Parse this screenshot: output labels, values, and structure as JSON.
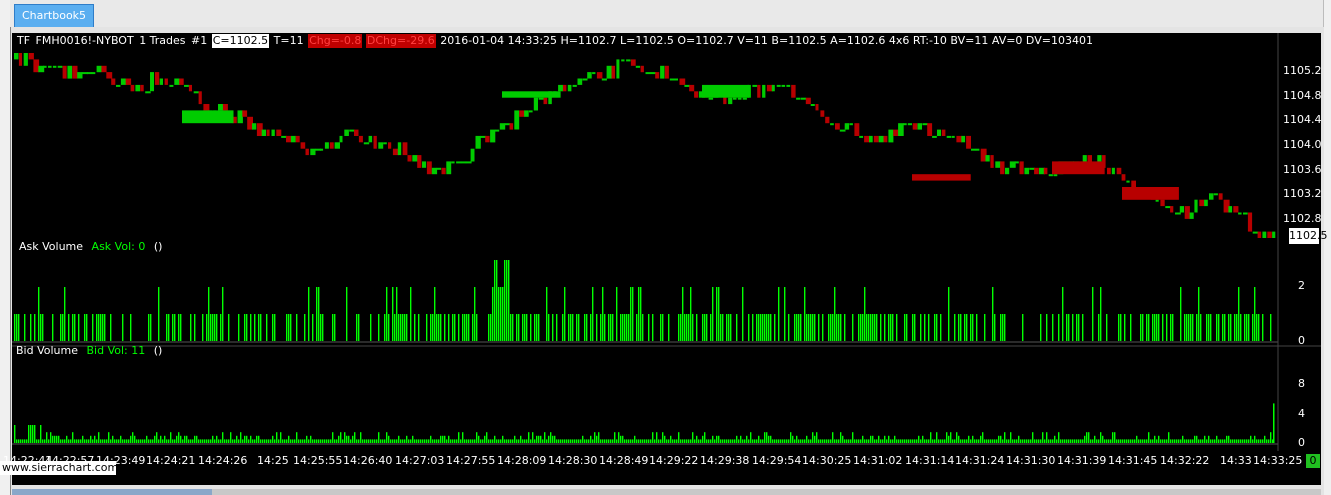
{
  "window": {
    "tab_label": "Chartbook5"
  },
  "header": {
    "symbol": "TF",
    "contract": "FMH0016!-NYBOT",
    "bars": "1 Trades",
    "num": "#1",
    "close": "C=1102.5",
    "trades": "T=11",
    "chg": "Chg=-0.8",
    "dchg": "DChg=-29.6",
    "rest": "2016-01-04 14:33:25 H=1102.7 L=1102.5 O=1102.7 V=11 B=1102.5 A=1102.6 4x6 RT:-10 BV=11 AV=0 DV=103401"
  },
  "price_axis": [
    "1105.2",
    "1104.8",
    "1104.4",
    "1104.0",
    "1103.6",
    "1103.2",
    "1102.8"
  ],
  "current_price": "1102.5",
  "ask_panel": {
    "title": "Ask Volume",
    "study": "Ask Vol: 0",
    "extra": "()",
    "axis": [
      "2",
      "0"
    ]
  },
  "bid_panel": {
    "title": "Bid Volume",
    "study": "Bid Vol: 11",
    "extra": "()",
    "axis": [
      "8",
      "4",
      "0"
    ],
    "zero_value": "0"
  },
  "time_axis": [
    "14:22:44",
    "14:22:57",
    "14:23:49",
    "14:24:21",
    "14:24:26",
    "14:25",
    "14:25:55",
    "14:26:40",
    "14:27:03",
    "14:27:55",
    "14:28:09",
    "14:28:30",
    "14:28:49",
    "14:29:22",
    "14:29:38",
    "14:29:54",
    "14:30:25",
    "14:31:02",
    "14:31:14",
    "14:31:24",
    "14:31:30",
    "14:31:39",
    "14:31:45",
    "14:32:22",
    "14:33",
    "14:33:25"
  ],
  "watermark": "www.sierrachart.com",
  "colors": {
    "up": "#00cc00",
    "down": "#b80000",
    "volume": "#00ff00",
    "background": "#000000",
    "tab": "#5aaef0"
  },
  "chart_data": [
    {
      "type": "candlestick",
      "title": "FMH0016!-NYBOT 1 Trades",
      "ylim": [
        1102.5,
        1105.4
      ],
      "y_ticks": [
        1105.2,
        1104.8,
        1104.4,
        1104.0,
        1103.6,
        1103.2,
        1102.8
      ],
      "close_path": [
        1105.3,
        1105.2,
        1105.1,
        1105.0,
        1104.9,
        1105.0,
        1104.6,
        1104.4,
        1104.2,
        1104.0,
        1103.9,
        1104.1,
        1104.0,
        1103.7,
        1103.5,
        1104.0,
        1104.3,
        1104.6,
        1104.9,
        1105.1,
        1105.2,
        1105.1,
        1104.8,
        1104.7,
        1104.8,
        1104.9,
        1104.5,
        1104.2,
        1104.0,
        1104.3,
        1104.1,
        1104.0,
        1103.7,
        1103.5,
        1103.6,
        1103.7,
        1103.5,
        1103.2,
        1102.9,
        1103.1,
        1102.8,
        1102.5
      ]
    },
    {
      "type": "bar",
      "title": "Ask Volume",
      "ylim": [
        0,
        3
      ],
      "y_ticks": [
        2,
        0
      ]
    },
    {
      "type": "bar",
      "title": "Bid Volume",
      "ylim": [
        0,
        11
      ],
      "y_ticks": [
        8,
        4,
        0
      ]
    }
  ]
}
